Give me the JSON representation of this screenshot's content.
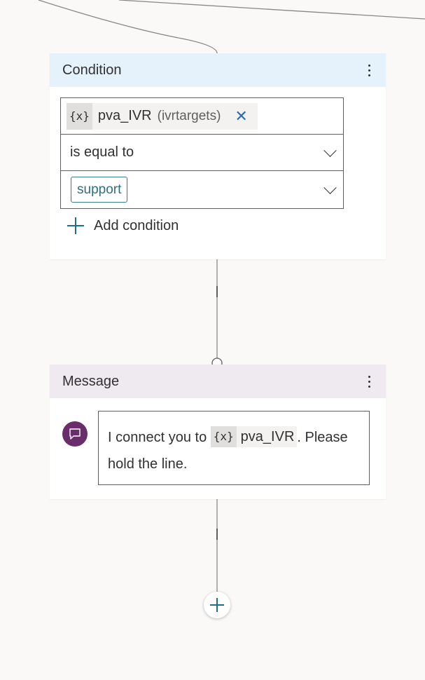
{
  "condition_node": {
    "title": "Condition",
    "variable": {
      "badge": "{x}",
      "name": "pva_IVR",
      "type": "(ivrtargets)",
      "remove_icon": "close-icon"
    },
    "operator": "is equal to",
    "value": "support",
    "add_condition_label": "Add condition"
  },
  "message_node": {
    "title": "Message",
    "icon": "chat-bubble-icon",
    "text_before": "I connect you to ",
    "variable": {
      "badge": "{x}",
      "name": "pva_IVR"
    },
    "text_after": ". Please hold the line."
  },
  "colors": {
    "condition_header": "#e6f2fb",
    "message_header": "#efe9f0",
    "message_avatar": "#6b2c6b",
    "accent": "#1f6f8b"
  }
}
